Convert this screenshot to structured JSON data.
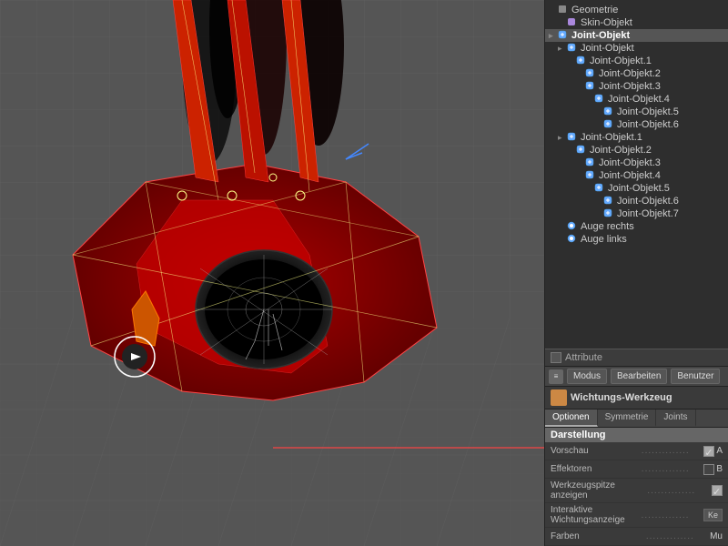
{
  "viewport": {
    "background": "#555555"
  },
  "scene_tree": {
    "items": [
      {
        "id": "geometrie",
        "label": "Geometrie",
        "indent": 0,
        "type": "geo",
        "selected": false,
        "bold": false
      },
      {
        "id": "skin-objekt",
        "label": "Skin-Objekt",
        "indent": 1,
        "type": "skin",
        "selected": false,
        "bold": false
      },
      {
        "id": "joint-objekt-root",
        "label": "Joint-Objekt",
        "indent": 0,
        "type": "joint",
        "selected": true,
        "bold": true
      },
      {
        "id": "joint-objekt-child1",
        "label": "Joint-Objekt",
        "indent": 1,
        "type": "joint",
        "selected": false,
        "bold": false
      },
      {
        "id": "joint-objekt-1-1",
        "label": "Joint-Objekt.1",
        "indent": 2,
        "type": "joint",
        "selected": false,
        "bold": false
      },
      {
        "id": "joint-objekt-1-2",
        "label": "Joint-Objekt.2",
        "indent": 3,
        "type": "joint",
        "selected": false,
        "bold": false
      },
      {
        "id": "joint-objekt-1-3",
        "label": "Joint-Objekt.3",
        "indent": 3,
        "type": "joint",
        "selected": false,
        "bold": false
      },
      {
        "id": "joint-objekt-1-4",
        "label": "Joint-Objekt.4",
        "indent": 4,
        "type": "joint",
        "selected": false,
        "bold": false
      },
      {
        "id": "joint-objekt-1-5",
        "label": "Joint-Objekt.5",
        "indent": 5,
        "type": "joint",
        "selected": false,
        "bold": false
      },
      {
        "id": "joint-objekt-1-6",
        "label": "Joint-Objekt.6",
        "indent": 5,
        "type": "joint",
        "selected": false,
        "bold": false
      },
      {
        "id": "joint-objekt-2-root",
        "label": "Joint-Objekt.1",
        "indent": 1,
        "type": "joint",
        "selected": false,
        "bold": false
      },
      {
        "id": "joint-objekt-2-2",
        "label": "Joint-Objekt.2",
        "indent": 2,
        "type": "joint",
        "selected": false,
        "bold": false
      },
      {
        "id": "joint-objekt-2-3",
        "label": "Joint-Objekt.3",
        "indent": 3,
        "type": "joint",
        "selected": false,
        "bold": false
      },
      {
        "id": "joint-objekt-2-4",
        "label": "Joint-Objekt.4",
        "indent": 3,
        "type": "joint",
        "selected": false,
        "bold": false
      },
      {
        "id": "joint-objekt-2-5",
        "label": "Joint-Objekt.5",
        "indent": 4,
        "type": "joint",
        "selected": false,
        "bold": false
      },
      {
        "id": "joint-objekt-2-6",
        "label": "Joint-Objekt.6",
        "indent": 5,
        "type": "joint",
        "selected": false,
        "bold": false
      },
      {
        "id": "joint-objekt-2-7",
        "label": "Joint-Objekt.7",
        "indent": 5,
        "type": "joint",
        "selected": false,
        "bold": false
      },
      {
        "id": "auge-rechts",
        "label": "Auge rechts",
        "indent": 1,
        "type": "eye",
        "selected": false,
        "bold": false
      },
      {
        "id": "auge-links",
        "label": "Auge links",
        "indent": 1,
        "type": "eye",
        "selected": false,
        "bold": false
      }
    ]
  },
  "attribute_bar": {
    "label": "Attribute"
  },
  "tab_toolbar": {
    "icon_label": "≡",
    "buttons": [
      "Modus",
      "Bearbeiten",
      "Benutzer"
    ]
  },
  "tool_info": {
    "label": "Wichtungs-Werkzeug"
  },
  "sub_tabs": [
    {
      "id": "optionen",
      "label": "Optionen",
      "active": true
    },
    {
      "id": "symmetrie",
      "label": "Symmetrie",
      "active": false
    },
    {
      "id": "joints",
      "label": "Joints",
      "active": false
    }
  ],
  "properties": {
    "section_title": "Darstellung",
    "rows": [
      {
        "label": "Vorschau",
        "has_checkbox": true,
        "checkbox_checked": true,
        "extra": "A"
      },
      {
        "label": "Effektoren",
        "has_checkbox": true,
        "checkbox_checked": false,
        "extra": "B"
      },
      {
        "label": "Werkzeugspitze anzeigen",
        "has_checkbox": true,
        "checkbox_checked": true,
        "extra": ""
      },
      {
        "label": "Interaktive Wichtungsanzeige",
        "has_button": true,
        "btn_label": "Ke"
      },
      {
        "label": "Farben",
        "has_text": true,
        "text_val": "Mu"
      }
    ]
  }
}
